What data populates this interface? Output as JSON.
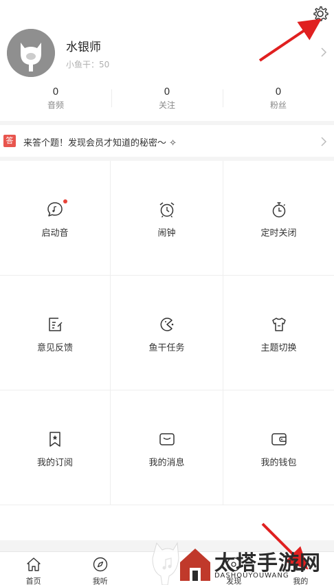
{
  "profile": {
    "username": "水银师",
    "subline": "小鱼干：50"
  },
  "stats": [
    {
      "value": "0",
      "label": "音频"
    },
    {
      "value": "0",
      "label": "关注"
    },
    {
      "value": "0",
      "label": "粉丝"
    }
  ],
  "banner": {
    "badge": "答",
    "text": "来答个题！发现会员才知道的秘密～ ✧"
  },
  "grid": [
    {
      "label": "启动音",
      "icon": "chat-music-icon",
      "badge_dot": true
    },
    {
      "label": "闹钟",
      "icon": "alarm-clock-icon"
    },
    {
      "label": "定时关闭",
      "icon": "stopwatch-icon"
    },
    {
      "label": "意见反馈",
      "icon": "feedback-icon"
    },
    {
      "label": "鱼干任务",
      "icon": "pacman-icon"
    },
    {
      "label": "主题切换",
      "icon": "tshirt-icon"
    },
    {
      "label": "我的订阅",
      "icon": "bookmark-icon"
    },
    {
      "label": "我的消息",
      "icon": "message-icon"
    },
    {
      "label": "我的钱包",
      "icon": "wallet-icon"
    }
  ],
  "tabs": [
    {
      "label": "首页",
      "icon": "home-icon"
    },
    {
      "label": "我听",
      "icon": "compass-icon"
    },
    {
      "label": "",
      "icon": "music-note-icon"
    },
    {
      "label": "发现",
      "icon": "discover-icon"
    },
    {
      "label": "我的",
      "icon": "profile-icon"
    }
  ],
  "watermark": {
    "title": "太塔手游网",
    "url": "DASHOUYOUWANG"
  },
  "colors": {
    "accent_red": "#e8554e",
    "annotation_red": "#e02020",
    "avatar_gray": "#8f8f8f"
  }
}
